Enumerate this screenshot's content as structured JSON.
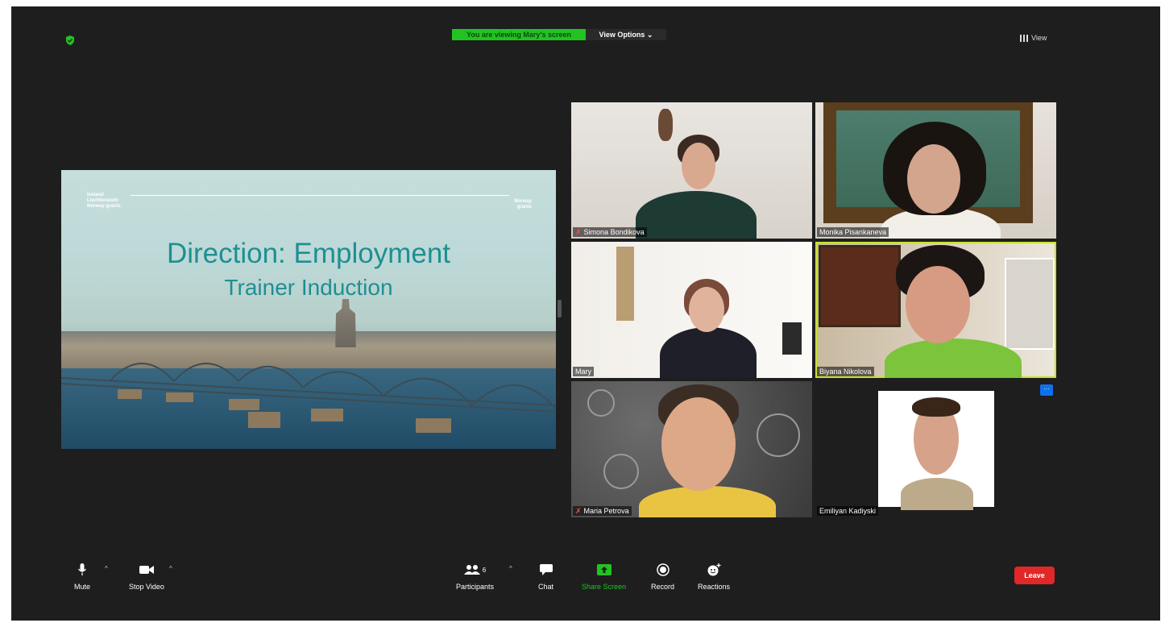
{
  "header": {
    "viewing_text": "You are viewing Mary's screen",
    "view_options_label": "View Options ⌄",
    "view_label": "View"
  },
  "shared_slide": {
    "logo_left_lines": [
      "Iceland",
      "Liechtenstein",
      "Norway grants"
    ],
    "logo_right_lines": [
      "Norway",
      "grants"
    ],
    "title_line1": "Direction: Employment",
    "title_line2": "Trainer Induction"
  },
  "participants": [
    {
      "name": "Simona Bondikova",
      "muted": true
    },
    {
      "name": "Monika Pisankaneva",
      "muted": false
    },
    {
      "name": "Mary",
      "muted": false
    },
    {
      "name": "Biyana Nikolova",
      "muted": false,
      "active_speaker": true
    },
    {
      "name": "Maria Petrova",
      "muted": true
    },
    {
      "name": "Emiliyan Kadiyski",
      "muted": false
    }
  ],
  "toolbar": {
    "mute_label": "Mute",
    "stop_video_label": "Stop Video",
    "participants_label": "Participants",
    "participants_count": "6",
    "chat_label": "Chat",
    "share_screen_label": "Share Screen",
    "record_label": "Record",
    "reactions_label": "Reactions",
    "leave_label": "Leave"
  },
  "colors": {
    "accent_green": "#23c223",
    "leave_red": "#e02828",
    "active_speaker": "#c9e22b",
    "slide_title": "#1f8f93"
  }
}
